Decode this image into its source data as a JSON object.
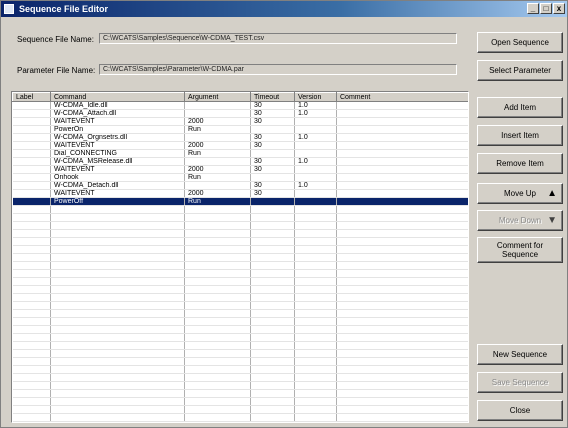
{
  "window": {
    "title": "Sequence File Editor",
    "controls": [
      "_",
      "□",
      "x"
    ]
  },
  "fields": {
    "sequence_label": "Sequence File Name:",
    "sequence_value": "C:\\WCATS\\Samples\\Sequence\\W-CDMA_TEST.csv",
    "parameter_label": "Parameter File Name:",
    "parameter_value": "C:\\WCATS\\Samples\\Parameter\\W-CDMA.par"
  },
  "table": {
    "columns": [
      "Label",
      "Command",
      "Argument",
      "Timeout",
      "Version",
      "Comment"
    ],
    "rows": [
      [
        "",
        "W-CDMA_Idle.dll",
        "",
        "30",
        "1.0",
        ""
      ],
      [
        "",
        "W-CDMA_Attach.dll",
        "",
        "30",
        "1.0",
        ""
      ],
      [
        "",
        "WAITEVENT",
        "2000",
        "30",
        "",
        ""
      ],
      [
        "",
        "PowerOn",
        "Run",
        "",
        "",
        ""
      ],
      [
        "",
        "W-CDMA_Orgnsetrs.dll",
        "",
        "30",
        "1.0",
        ""
      ],
      [
        "",
        "WAITEVENT",
        "2000",
        "30",
        "",
        ""
      ],
      [
        "",
        "Dial_CONNECTING",
        "Run",
        "",
        "",
        ""
      ],
      [
        "",
        "W-CDMA_MSRelease.dll",
        "",
        "30",
        "1.0",
        ""
      ],
      [
        "",
        "WAITEVENT",
        "2000",
        "30",
        "",
        ""
      ],
      [
        "",
        "Onhook",
        "Run",
        "",
        "",
        ""
      ],
      [
        "",
        "W-CDMA_Detach.dll",
        "",
        "30",
        "1.0",
        ""
      ],
      [
        "",
        "WAITEVENT",
        "2000",
        "30",
        "",
        ""
      ],
      [
        "",
        "PowerOff",
        "Run",
        "",
        "",
        ""
      ]
    ],
    "selected_row": 12
  },
  "buttons": {
    "open_sequence": "Open Sequence",
    "select_parameter": "Select Parameter",
    "add_item": "Add Item",
    "insert_item": "Insert Item",
    "remove_item": "Remove Item",
    "move_up": "Move Up",
    "move_down": "Move Down",
    "comment": "Comment for Sequence",
    "new_sequence": "New Sequence",
    "save_sequence": "Save Sequence",
    "close": "Close"
  }
}
